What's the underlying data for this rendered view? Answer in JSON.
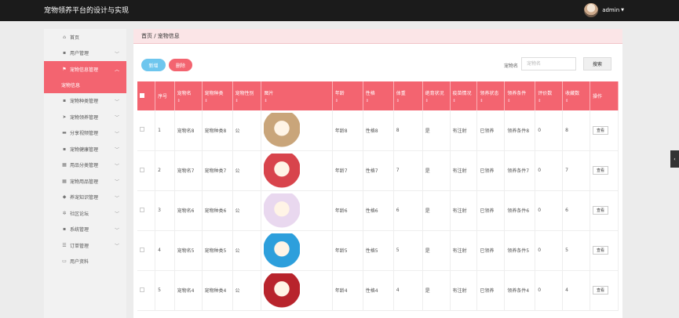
{
  "app": {
    "title": "宠物领养平台的设计与实现",
    "user": "admin"
  },
  "sidebar": {
    "items": [
      {
        "label": "首页",
        "icon": "home-icon",
        "glyph": "⌂",
        "chevron": false,
        "active": false
      },
      {
        "label": "用户管理",
        "icon": "user-icon",
        "glyph": "▪",
        "chevron": true,
        "active": false
      },
      {
        "label": "宠物信息管理",
        "icon": "flag-icon",
        "glyph": "⚑",
        "chevron": true,
        "active": true,
        "sub": [
          "宠物信息"
        ]
      },
      {
        "label": "宠物种类管理",
        "icon": "box-icon",
        "glyph": "▪",
        "chevron": true,
        "active": false
      },
      {
        "label": "宠物领养管理",
        "icon": "send-icon",
        "glyph": "➤",
        "chevron": true,
        "active": false
      },
      {
        "label": "分享视频管理",
        "icon": "video-icon",
        "glyph": "▬",
        "chevron": true,
        "active": false
      },
      {
        "label": "宠物健康管理",
        "icon": "box-icon",
        "glyph": "▪",
        "chevron": true,
        "active": false
      },
      {
        "label": "用品分类管理",
        "icon": "grid-icon",
        "glyph": "▦",
        "chevron": true,
        "active": false
      },
      {
        "label": "宠物用品管理",
        "icon": "grid-icon",
        "glyph": "▦",
        "chevron": true,
        "active": false
      },
      {
        "label": "养宠知识管理",
        "icon": "shield-icon",
        "glyph": "◆",
        "chevron": true,
        "active": false
      },
      {
        "label": "社区论坛",
        "icon": "gear-icon",
        "glyph": "✲",
        "chevron": true,
        "active": false
      },
      {
        "label": "系统管理",
        "icon": "system-icon",
        "glyph": "▪",
        "chevron": true,
        "active": false
      },
      {
        "label": "订单管理",
        "icon": "list-icon",
        "glyph": "☰",
        "chevron": true,
        "active": false
      },
      {
        "label": "用户资料",
        "icon": "card-icon",
        "glyph": "▭",
        "chevron": false,
        "active": false
      }
    ]
  },
  "breadcrumb": "首页 / 宠物信息",
  "toolbar": {
    "add_label": "新增",
    "delete_label": "删除",
    "search_label": "宠物名",
    "search_placeholder": "宠物名",
    "search_button": "搜索"
  },
  "table": {
    "sort_glyph": "⇕",
    "headers": [
      "序号",
      "宠物名",
      "宠物种类",
      "宠物性别",
      "图片",
      "年龄",
      "性格",
      "体重",
      "绝育状况",
      "疫苗情况",
      "领养状态",
      "领养条件",
      "评价数",
      "收藏数",
      "操作"
    ],
    "sortable": [
      false,
      true,
      true,
      true,
      true,
      true,
      true,
      true,
      true,
      true,
      true,
      true,
      true,
      true,
      false
    ],
    "action_label": "查看",
    "rows": [
      {
        "no": "1",
        "name": "宠物名8",
        "type": "宠物种类8",
        "gender": "公",
        "img": "#c9a57a",
        "age": "年龄8",
        "char": "性格8",
        "weight": "8",
        "neuter": "是",
        "vaccine": "有注射",
        "status": "已领养",
        "cond": "领养条件8",
        "rev": "0",
        "fav": "8"
      },
      {
        "no": "2",
        "name": "宠物名7",
        "type": "宠物种类7",
        "gender": "公",
        "img": "#d8444c",
        "age": "年龄7",
        "char": "性格7",
        "weight": "7",
        "neuter": "是",
        "vaccine": "有注射",
        "status": "已领养",
        "cond": "领养条件7",
        "rev": "0",
        "fav": "7"
      },
      {
        "no": "3",
        "name": "宠物名6",
        "type": "宠物种类6",
        "gender": "公",
        "img": "#e9d8ef",
        "age": "年龄6",
        "char": "性格6",
        "weight": "6",
        "neuter": "是",
        "vaccine": "有注射",
        "status": "已领养",
        "cond": "领养条件6",
        "rev": "0",
        "fav": "6"
      },
      {
        "no": "4",
        "name": "宠物名5",
        "type": "宠物种类5",
        "gender": "公",
        "img": "#2d9fdc",
        "age": "年龄5",
        "char": "性格5",
        "weight": "5",
        "neuter": "是",
        "vaccine": "有注射",
        "status": "已领养",
        "cond": "领养条件5",
        "rev": "0",
        "fav": "5"
      },
      {
        "no": "5",
        "name": "宠物名4",
        "type": "宠物种类4",
        "gender": "公",
        "img": "#b8242c",
        "age": "年龄4",
        "char": "性格4",
        "weight": "4",
        "neuter": "是",
        "vaccine": "有注射",
        "status": "已领养",
        "cond": "领养条件4",
        "rev": "0",
        "fav": "4"
      }
    ]
  }
}
